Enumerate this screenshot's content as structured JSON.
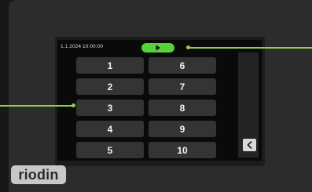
{
  "status_bar": {
    "datetime": "1.1.2024 10:00:00",
    "play_icon": "play-icon"
  },
  "keypad": {
    "keys": [
      "1",
      "2",
      "3",
      "4",
      "5",
      "6",
      "7",
      "8",
      "9",
      "10"
    ]
  },
  "nav": {
    "back_icon": "chevron-left-icon"
  },
  "branding": {
    "logo_text": "riodin"
  },
  "colors": {
    "accent_green": "#55d43a",
    "callout_line": "#8fd14f",
    "key_background": "#343434",
    "screen_background": "#0a0a0a"
  }
}
